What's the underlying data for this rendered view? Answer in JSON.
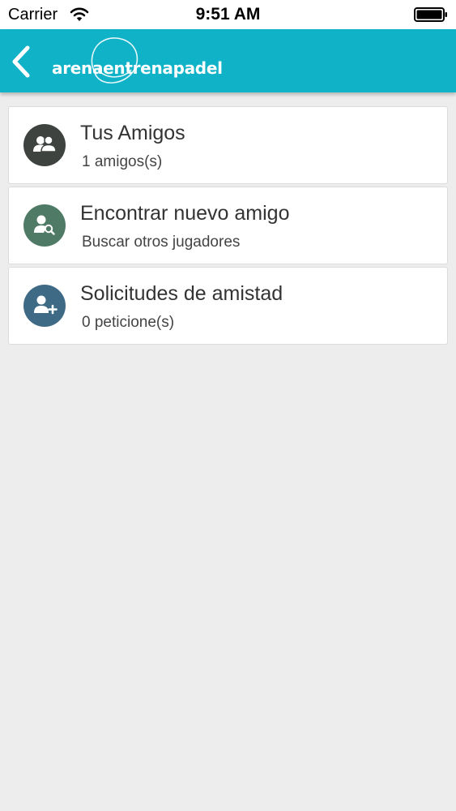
{
  "status_bar": {
    "carrier": "Carrier",
    "time": "9:51 AM",
    "icons": [
      "wifi-icon",
      "battery-icon"
    ]
  },
  "nav_bar": {
    "brand": "arenaentrenapadel",
    "back_icon": "chevron-left-icon",
    "color": "#10b2c8"
  },
  "menu": {
    "items": [
      {
        "title": "Tus Amigos",
        "subtitle": "1 amigos(s)",
        "icon": "friends-icon",
        "icon_color": "#3e4340"
      },
      {
        "title": "Encontrar nuevo amigo",
        "subtitle": "Buscar otros jugadores",
        "icon": "search-user-icon",
        "icon_color": "#4f7a66"
      },
      {
        "title": "Solicitudes de amistad",
        "subtitle": "0 peticione(s)",
        "icon": "add-user-icon",
        "icon_color": "#3e6a86"
      }
    ]
  }
}
